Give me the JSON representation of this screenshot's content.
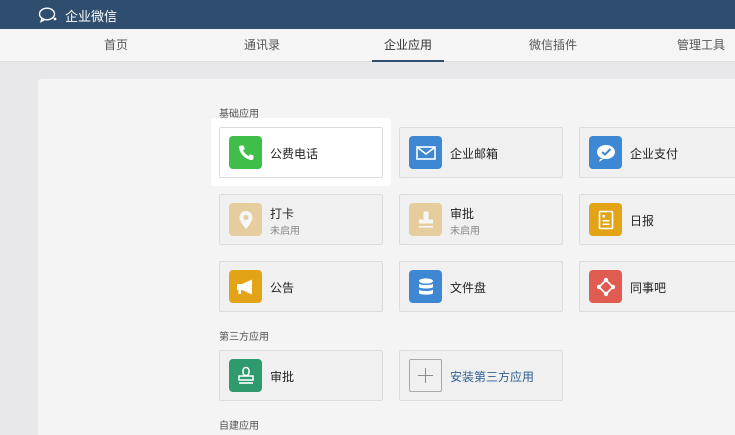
{
  "app": {
    "title": "企业微信"
  },
  "nav": {
    "tabs": [
      {
        "label": "首页"
      },
      {
        "label": "通讯录"
      },
      {
        "label": "企业应用"
      },
      {
        "label": "微信插件"
      },
      {
        "label": "管理工具"
      }
    ],
    "active_tab": "企业应用"
  },
  "sections": {
    "basic": {
      "title": "基础应用",
      "apps": [
        {
          "name": "公费电话",
          "icon": "phone-icon",
          "color": "#3fbf4a"
        },
        {
          "name": "企业邮箱",
          "icon": "mail-icon",
          "color": "#3e87d3"
        },
        {
          "name": "企业支付",
          "icon": "payment-icon",
          "color": "#3e87d3"
        },
        {
          "name": "打卡",
          "status": "未启用",
          "icon": "location-pin-icon",
          "color": "#d9a43a"
        },
        {
          "name": "审批",
          "status": "未启用",
          "icon": "stamp-icon",
          "color": "#d9a43a"
        },
        {
          "name": "日报",
          "icon": "report-icon",
          "color": "#e2a317"
        },
        {
          "name": "公告",
          "icon": "megaphone-icon",
          "color": "#e2a317"
        },
        {
          "name": "文件盘",
          "icon": "database-icon",
          "color": "#3e87d3"
        },
        {
          "name": "同事吧",
          "icon": "network-icon",
          "color": "#e05b50"
        }
      ]
    },
    "third_party": {
      "title": "第三方应用",
      "apps": [
        {
          "name": "审批",
          "icon": "stamp-icon",
          "color": "#2e9a6d"
        },
        {
          "name": "安装第三方应用",
          "icon": "plus-icon"
        }
      ]
    },
    "custom": {
      "title": "自建应用"
    }
  }
}
